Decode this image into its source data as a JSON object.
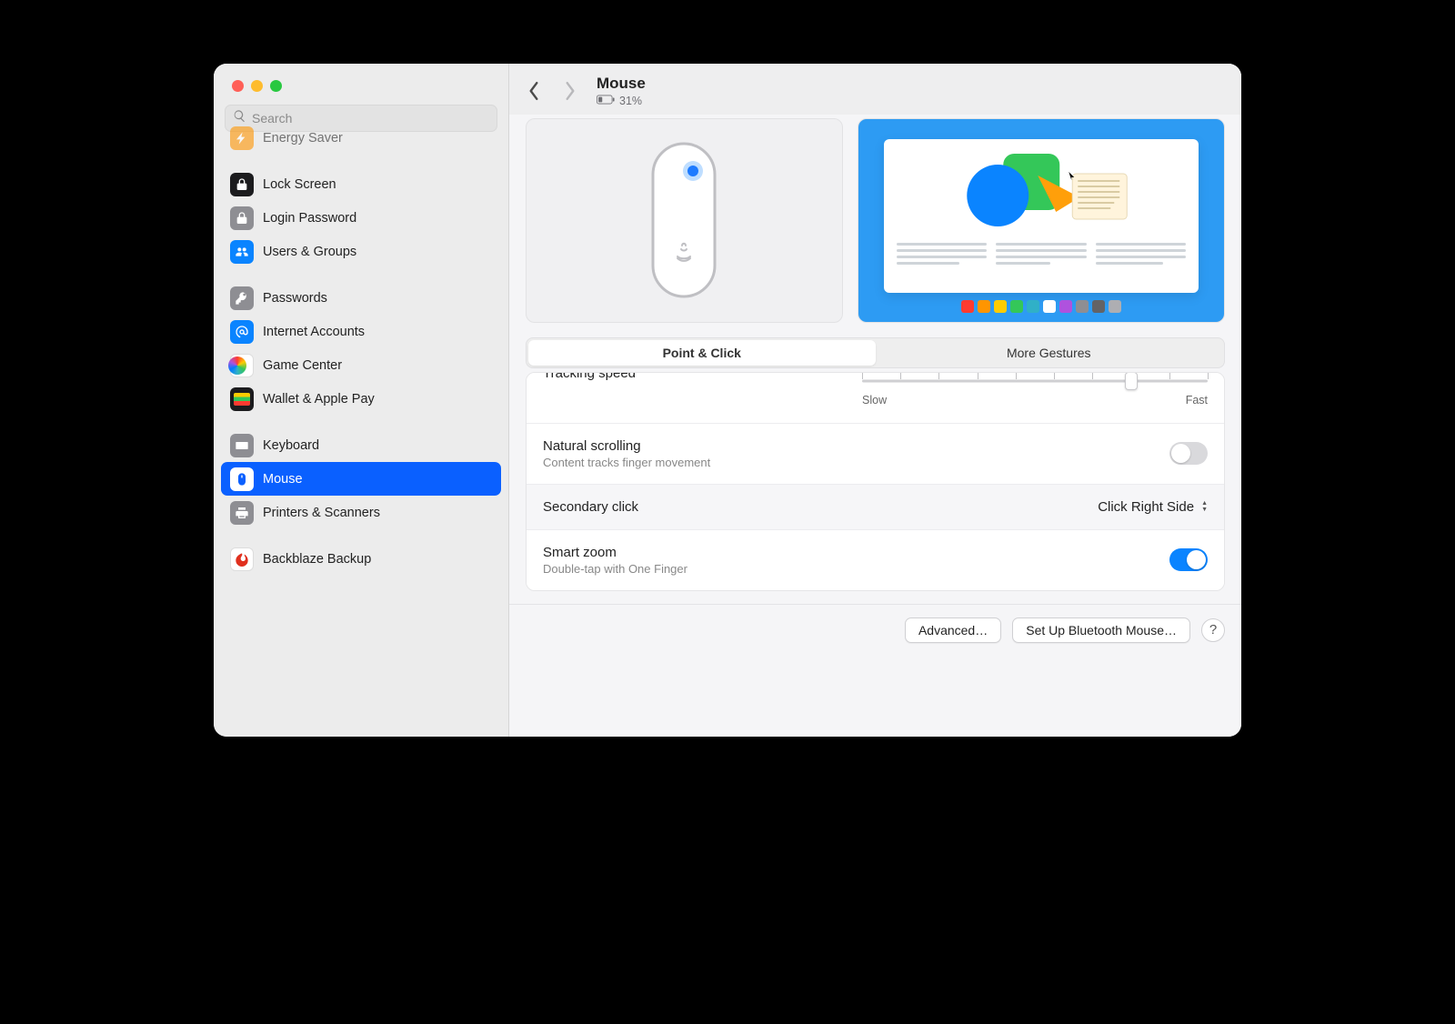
{
  "window_title": "Mouse",
  "battery_percent": "31%",
  "search_placeholder": "Search",
  "sidebar": {
    "items": [
      {
        "id": "energy",
        "label": "Energy Saver"
      },
      {
        "id": "lock-screen",
        "label": "Lock Screen"
      },
      {
        "id": "login-password",
        "label": "Login Password"
      },
      {
        "id": "users-groups",
        "label": "Users & Groups"
      },
      {
        "id": "passwords",
        "label": "Passwords"
      },
      {
        "id": "internet",
        "label": "Internet Accounts"
      },
      {
        "id": "game-center",
        "label": "Game Center"
      },
      {
        "id": "wallet",
        "label": "Wallet & Apple Pay"
      },
      {
        "id": "keyboard",
        "label": "Keyboard"
      },
      {
        "id": "mouse",
        "label": "Mouse"
      },
      {
        "id": "printers",
        "label": "Printers & Scanners"
      },
      {
        "id": "backblaze",
        "label": "Backblaze Backup"
      }
    ],
    "active_id": "mouse"
  },
  "tabs": {
    "options": [
      "Point & Click",
      "More Gestures"
    ],
    "active_index": 0
  },
  "settings": {
    "tracking_label": "Tracking speed",
    "tracking_slow": "Slow",
    "tracking_fast": "Fast",
    "tracking_value": 8,
    "tracking_steps": 10,
    "natural_scroll_label": "Natural scrolling",
    "natural_scroll_sub": "Content tracks finger movement",
    "natural_scroll_on": false,
    "secondary_label": "Secondary click",
    "secondary_value": "Click Right Side",
    "smart_zoom_label": "Smart zoom",
    "smart_zoom_sub": "Double-tap with One Finger",
    "smart_zoom_on": true
  },
  "buttons": {
    "advanced": "Advanced…",
    "setup": "Set Up Bluetooth Mouse…",
    "help": "?"
  }
}
